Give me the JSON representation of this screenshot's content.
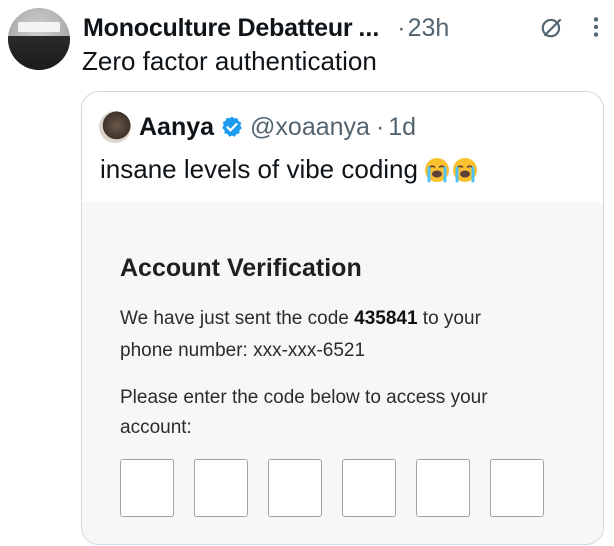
{
  "tweet": {
    "author_name": "Monoculture Debatteur",
    "name_truncation": "...",
    "dot": "·",
    "time": "23h",
    "text": "Zero factor authentication",
    "icons": {
      "grok": "grok-icon",
      "more": "more-vertical-icon",
      "avatar": "avatar-photo"
    }
  },
  "quote": {
    "name": "Aanya",
    "handle": "@xoaanya",
    "dot": "·",
    "time": "1d",
    "text": "insane levels of vibe coding",
    "emojis": [
      "loudly-crying-face-emoji",
      "loudly-crying-face-emoji"
    ],
    "verified_color": "#1d9bf0"
  },
  "verification_screen": {
    "title": "Account Verification",
    "line1_prefix": "We have just sent the code ",
    "code": "435841",
    "line1_suffix": " to your",
    "line2": "phone number: xxx-xxx-6521",
    "line3": "Please enter the code below to access your",
    "line4": "account:",
    "input_count": 6
  },
  "colors": {
    "text": "#0f1419",
    "muted": "#536471",
    "border": "#cfd9de",
    "accent": "#1d9bf0"
  }
}
